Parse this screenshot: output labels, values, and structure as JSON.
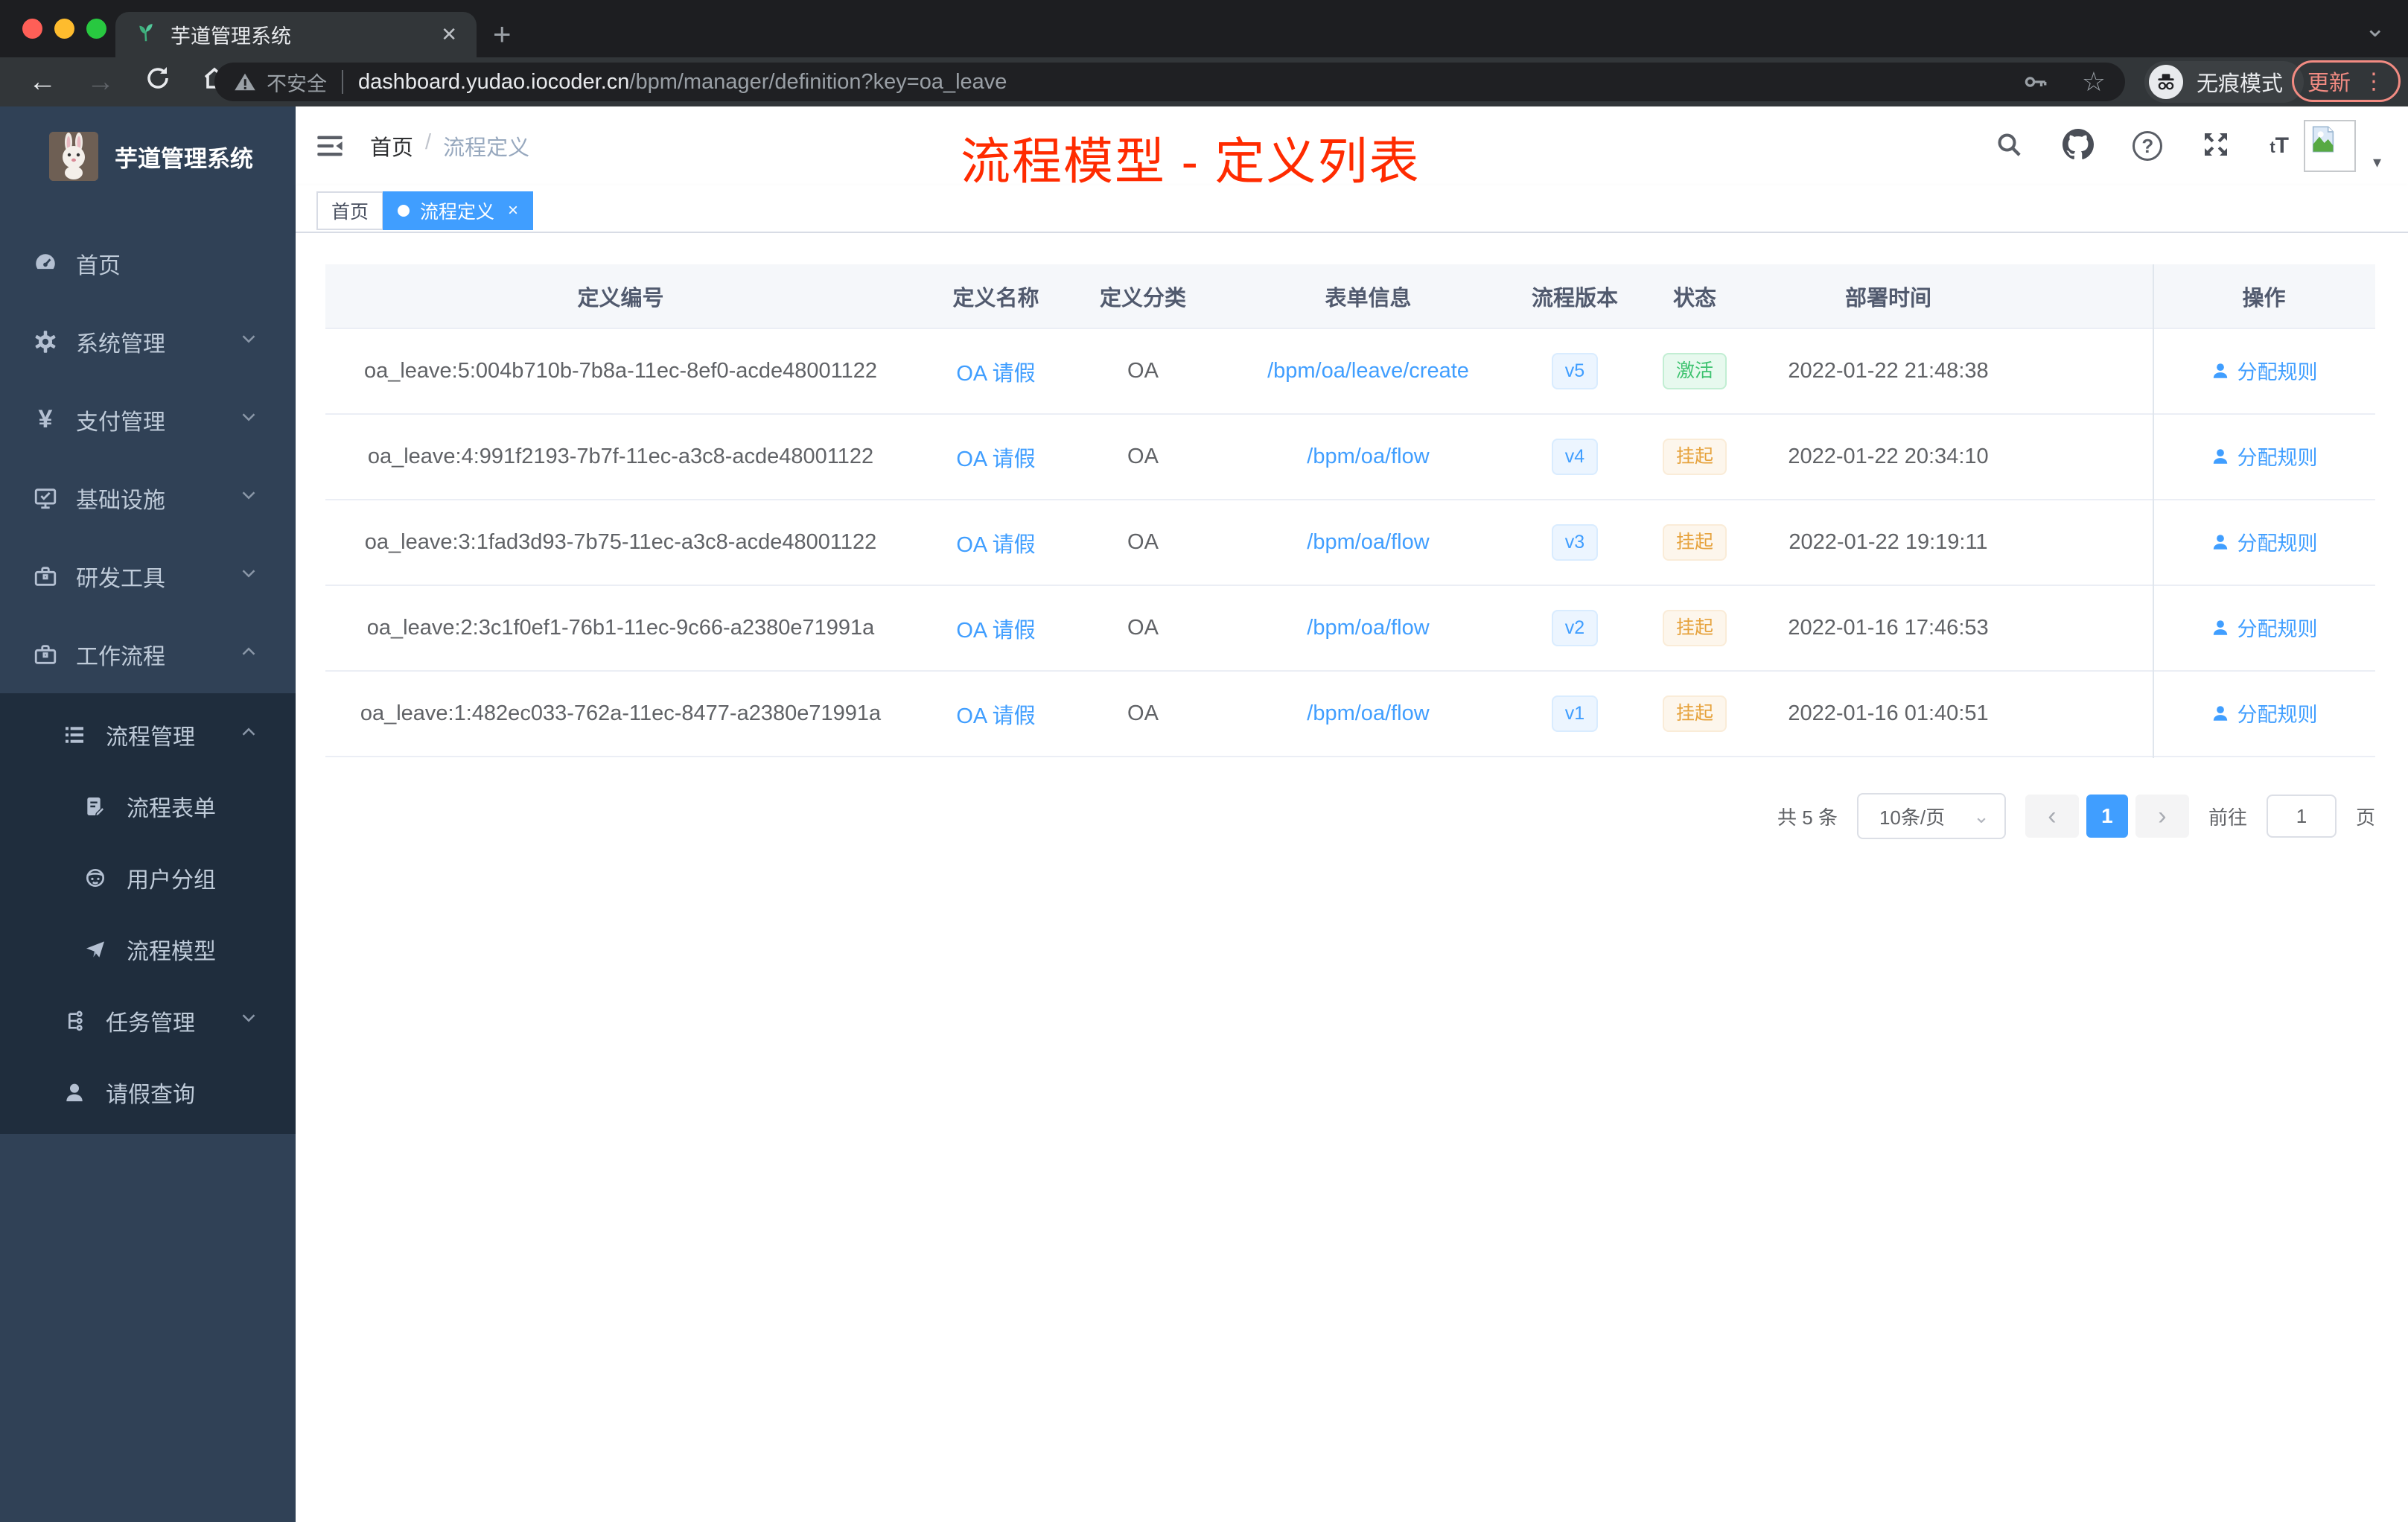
{
  "browser": {
    "tab_title": "芋道管理系统",
    "security_label": "不安全",
    "url_host": "dashboard.yudao.iocoder.cn",
    "url_path": "/bpm/manager/definition?key=oa_leave",
    "incognito_label": "无痕模式",
    "update_label": "更新"
  },
  "glyphs": {
    "tab_close": "✕",
    "new_tab": "+",
    "tab_search_caret": "⌄",
    "back_arrow": "←",
    "forward_arrow": "→",
    "star": "☆",
    "update_dots": "⋮",
    "avatar_caret": "▾",
    "yen": "¥",
    "question": "?",
    "text_size": "tT",
    "tag_close": "×",
    "prev": "‹",
    "next": "›",
    "select_caret": "⌄"
  },
  "sidebar": {
    "title": "芋道管理系统",
    "items": [
      {
        "label": "首页"
      },
      {
        "label": "系统管理"
      },
      {
        "label": "支付管理"
      },
      {
        "label": "基础设施"
      },
      {
        "label": "研发工具"
      },
      {
        "label": "工作流程"
      },
      {
        "label": "流程管理"
      },
      {
        "label": "流程表单"
      },
      {
        "label": "用户分组"
      },
      {
        "label": "流程模型"
      },
      {
        "label": "任务管理"
      },
      {
        "label": "请假查询"
      }
    ]
  },
  "header": {
    "breadcrumb_home": "首页",
    "breadcrumb_sep": "/",
    "breadcrumb_current": "流程定义"
  },
  "overlay_title": "流程模型 - 定义列表",
  "tags": {
    "home": "首页",
    "active": "流程定义"
  },
  "table": {
    "columns": {
      "id": "定义编号",
      "name": "定义名称",
      "category": "定义分类",
      "form": "表单信息",
      "version": "流程版本",
      "status": "状态",
      "deploy_time": "部署时间",
      "action": "操作"
    },
    "rows": [
      {
        "id": "oa_leave:5:004b710b-7b8a-11ec-8ef0-acde48001122",
        "name": "OA 请假",
        "category": "OA",
        "form": "/bpm/oa/leave/create",
        "version": "v5",
        "status": "激活",
        "deploy_time": "2022-01-22 21:48:38",
        "action": "分配规则"
      },
      {
        "id": "oa_leave:4:991f2193-7b7f-11ec-a3c8-acde48001122",
        "name": "OA 请假",
        "category": "OA",
        "form": "/bpm/oa/flow",
        "version": "v4",
        "status": "挂起",
        "deploy_time": "2022-01-22 20:34:10",
        "action": "分配规则"
      },
      {
        "id": "oa_leave:3:1fad3d93-7b75-11ec-a3c8-acde48001122",
        "name": "OA 请假",
        "category": "OA",
        "form": "/bpm/oa/flow",
        "version": "v3",
        "status": "挂起",
        "deploy_time": "2022-01-22 19:19:11",
        "action": "分配规则"
      },
      {
        "id": "oa_leave:2:3c1f0ef1-76b1-11ec-9c66-a2380e71991a",
        "name": "OA 请假",
        "category": "OA",
        "form": "/bpm/oa/flow",
        "version": "v2",
        "status": "挂起",
        "deploy_time": "2022-01-16 17:46:53",
        "action": "分配规则"
      },
      {
        "id": "oa_leave:1:482ec033-762a-11ec-8477-a2380e71991a",
        "name": "OA 请假",
        "category": "OA",
        "form": "/bpm/oa/flow",
        "version": "v1",
        "status": "挂起",
        "deploy_time": "2022-01-16 01:40:51",
        "action": "分配规则"
      }
    ]
  },
  "pagination": {
    "total": "共 5 条",
    "page_size": "10条/页",
    "page": "1",
    "goto_label": "前往",
    "goto_value": "1",
    "unit_label": "页"
  },
  "colors": {
    "accent_blue": "#409eff",
    "sidebar_bg": "#304156",
    "submenu_bg": "#1f2d3d",
    "success_green": "#3cc26e",
    "warning_orange": "#e6a23c",
    "title_red": "#ff2b00"
  }
}
